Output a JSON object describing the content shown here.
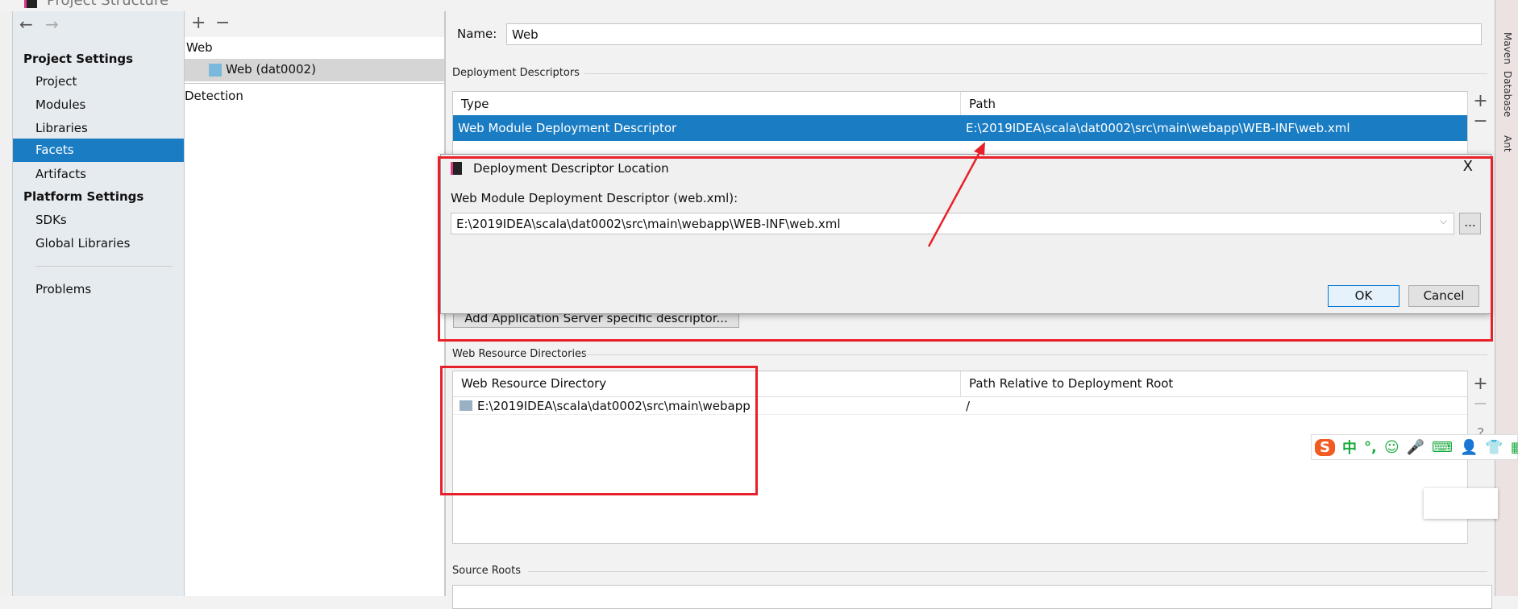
{
  "window": {
    "title": "Project Structure"
  },
  "sidebar": {
    "back": "←",
    "forward": "→",
    "project_settings": "Project Settings",
    "items": [
      "Project",
      "Modules",
      "Libraries",
      "Facets",
      "Artifacts"
    ],
    "platform_settings": "Platform Settings",
    "platform_items": [
      "SDKs",
      "Global Libraries"
    ],
    "problems": "Problems",
    "selected": "Facets"
  },
  "facets": {
    "add": "+",
    "remove": "−",
    "group": "Web",
    "item": "Web (dat0002)",
    "detection": "Detection"
  },
  "main": {
    "name_label": "Name:",
    "name_value": "Web",
    "deployment_descriptors": "Deployment Descriptors",
    "dd_table": {
      "headers": [
        "Type",
        "Path"
      ],
      "rows": [
        [
          "Web Module Deployment Descriptor",
          "E:\\2019IDEA\\scala\\dat0002\\src\\main\\webapp\\WEB-INF\\web.xml"
        ]
      ]
    },
    "add_server_descriptor": "Add Application Server specific descriptor...",
    "web_resource_directories": "Web Resource Directories",
    "wr_table": {
      "headers": [
        "Web Resource Directory",
        "Path Relative to Deployment Root"
      ],
      "rows": [
        [
          "E:\\2019IDEA\\scala\\dat0002\\src\\main\\webapp",
          "/"
        ]
      ]
    },
    "source_roots": "Source Roots",
    "side_add": "+",
    "side_remove": "−",
    "side_help": "?"
  },
  "dialog": {
    "title": "Deployment Descriptor Location",
    "close": "X",
    "label": "Web Module Deployment Descriptor (web.xml):",
    "value": "E:\\2019IDEA\\scala\\dat0002\\src\\main\\webapp\\WEB-INF\\web.xml",
    "browse": "...",
    "ok": "OK",
    "cancel": "Cancel"
  },
  "ide_strip": {
    "tabs": [
      "Maven",
      "Database",
      "Ant"
    ]
  },
  "ime": {
    "logo": "S",
    "items": [
      "中",
      "°,",
      "☺",
      "🎤",
      "⌨",
      "👤",
      "👕",
      "▦"
    ]
  },
  "colors": {
    "selection": "#1a7dc4",
    "annotation_red": "#e8202a",
    "ime_green": "#1aab3f"
  }
}
